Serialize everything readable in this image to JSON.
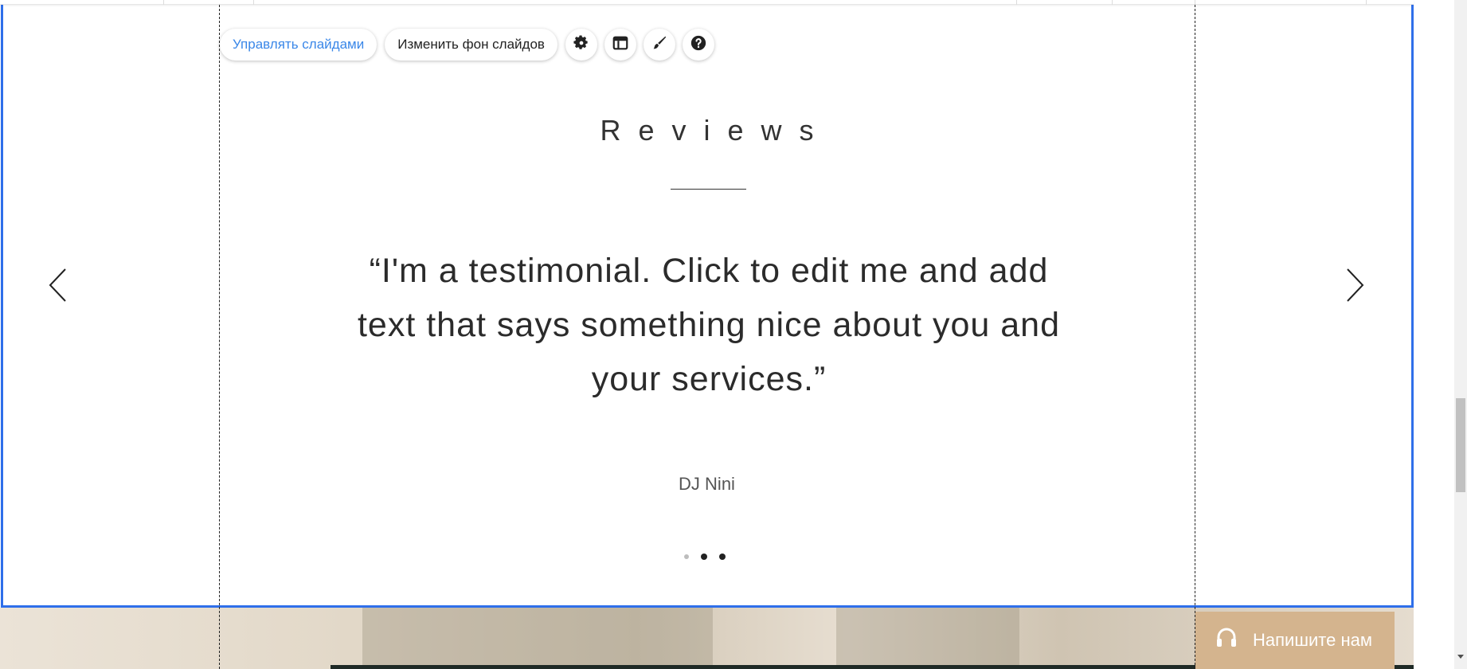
{
  "toolbar": {
    "manage_slides_label": "Управлять слайдами",
    "change_background_label": "Изменить фон слайдов",
    "settings_icon": "gear-icon",
    "layout_icon": "layout-icon",
    "design_icon": "brush-icon",
    "help_icon": "help-icon"
  },
  "slide": {
    "title": "Reviews",
    "quote": "“I'm a testimonial. Click to edit me and add text that says something nice about you and your services.”",
    "author": "DJ Nini",
    "dots_count": 3,
    "active_dot": 1
  },
  "navigation": {
    "prev_icon": "chevron-left-icon",
    "next_icon": "chevron-right-icon"
  },
  "chat": {
    "label": "Напишите нам",
    "icon": "headset-icon"
  },
  "colors": {
    "selection_border": "#2f6fea",
    "primary_link": "#3a87e8",
    "chat_bg": "#d4b48e"
  }
}
